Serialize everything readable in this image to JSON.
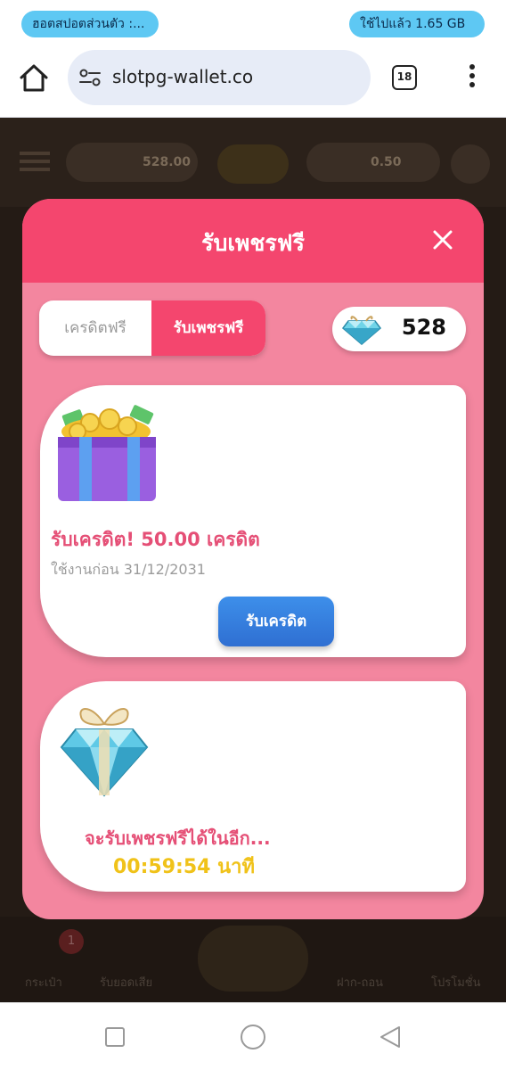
{
  "status_bar": {
    "hotspot_text": "ฮอตสปอตส่วนตัว :...",
    "data_usage_text": "ใช้ไปแล้ว 1.65 GB",
    "pill_color": "#5ec8f3"
  },
  "browser": {
    "url": "slotpg-wallet.co",
    "tab_count": "18",
    "icons": [
      "home-icon",
      "site-settings-icon",
      "tabs-icon",
      "more-menu-icon"
    ]
  },
  "background_game": {
    "balance_left": "528.00",
    "balance_right": "0.50",
    "nav_badge": "1",
    "nav_items": [
      "กระเป๋า",
      "รับยอดเสีย",
      "ฝาก-ถอน",
      "โปรโมชั่น"
    ]
  },
  "modal": {
    "title": "รับเพชรฟรี",
    "header_color": "#f4466e",
    "body_color": "#f3869f",
    "tabs": [
      {
        "label": "เครดิตฟรี",
        "active": false
      },
      {
        "label": "รับเพชรฟรี",
        "active": true
      }
    ],
    "diamond_balance": "528",
    "credit_card": {
      "title": "รับเครดิต! 50.00 เครดิต",
      "expiry": "ใช้งานก่อน 31/12/2031",
      "button_label": "รับเครดิต"
    },
    "diamond_card": {
      "label": "จะรับเพชรฟรีได้ในอีก...",
      "countdown": "00:59:54 นาที"
    }
  },
  "system_nav": {
    "buttons": [
      "recents-button",
      "home-button",
      "back-button"
    ]
  }
}
